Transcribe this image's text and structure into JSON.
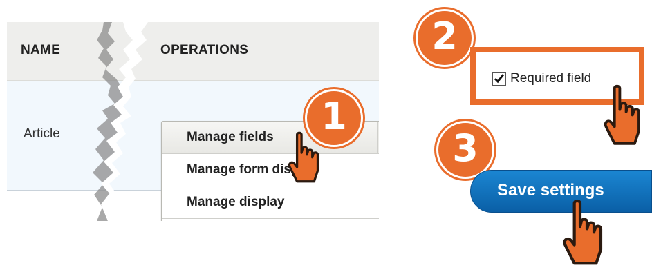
{
  "table": {
    "headers": {
      "name": "NAME",
      "operations": "OPERATIONS"
    },
    "rows": [
      {
        "name": "Article"
      }
    ]
  },
  "dropdown": {
    "items": [
      {
        "label": "Manage fields"
      },
      {
        "label": "Manage form display"
      },
      {
        "label": "Manage display"
      }
    ]
  },
  "steps": [
    "1",
    "2",
    "3"
  ],
  "required_field": {
    "label": "Required field",
    "checked": true
  },
  "save_button": {
    "label": "Save settings"
  },
  "colors": {
    "accent": "#e96d2c",
    "button_blue": "#0a6fbd",
    "row_highlight": "#f2f8fd",
    "header_bg": "#eeeeec"
  },
  "icons": [
    "hand-pointer-icon",
    "checkbox-checked-icon"
  ]
}
